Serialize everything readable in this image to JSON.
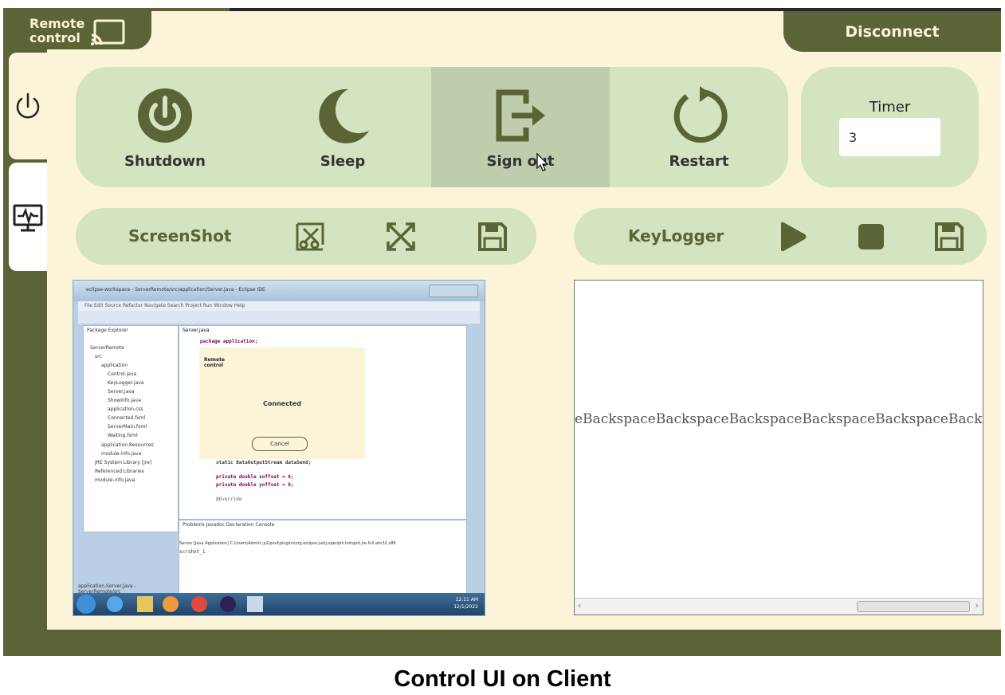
{
  "app": {
    "logo_line1": "Remote",
    "logo_line2": "control",
    "disconnect_label": "Disconnect"
  },
  "power": {
    "buttons": [
      {
        "label": "Shutdown",
        "icon": "power-icon"
      },
      {
        "label": "Sleep",
        "icon": "moon-icon"
      },
      {
        "label": "Sign out",
        "icon": "sign-out-icon",
        "hovered": true
      },
      {
        "label": "Restart",
        "icon": "restart-icon"
      }
    ]
  },
  "timer": {
    "label": "Timer",
    "value": "3"
  },
  "screenshot": {
    "label": "ScreenShot",
    "icons": [
      "crop-icon",
      "fullscreen-icon",
      "save-icon"
    ]
  },
  "keylogger": {
    "label": "KeyLogger",
    "icons": [
      "play-icon",
      "stop-icon",
      "save-icon"
    ],
    "log_text": "eBackspaceBackspaceBackspaceBackspaceBackspaceBackspace"
  },
  "remote_screen": {
    "window_title": "eclipse-workspace - ServerRemote/src/application/Server.java - Eclipse IDE",
    "menu": "File  Edit  Source  Refactor  Navigate  Search  Project  Run  Window  Help",
    "package_explorer_title": "Package Explorer",
    "tree": [
      "ServerRemote",
      "src",
      "application",
      "Control.java",
      "KeyLogger.java",
      "Server.java",
      "ShowInfo.java",
      "application.css",
      "Connected.fxml",
      "ServerMain.fxml",
      "Waiting.fxml",
      "application.Resources",
      "module-info.java",
      "JRE System Library [jre]",
      "Referenced Libraries",
      "module-info.java"
    ],
    "editor_tab": "Server.java",
    "code_line1": "package application;",
    "code_line2": "static DataOutputStream dataSend;",
    "code_line3": "private double xoffset = 0;",
    "code_line4": "private double yoffset = 0;",
    "code_line5": "@Override",
    "dialog_logo1": "Remote",
    "dialog_logo2": "control",
    "dialog_status": "Connected",
    "dialog_cancel": "Cancel",
    "console_tabs": "Problems  Javadoc  Declaration  Console",
    "console_line1": "Server [Java Application] C:\\Users\\Admin\\.p2\\pool\\plugins\\org.eclipse.justj.openjdk.hotspot.jre.full.win32.x86",
    "console_line2": "scrshot_1",
    "status_bar": "application.Server.java - ServerRemote/src",
    "clock_time": "12:11 AM",
    "clock_date": "12/1/2022"
  },
  "caption": "Control UI on Client",
  "colors": {
    "olive": "#5b6436",
    "cream": "#fbf4d8",
    "panel": "#d4e3c0",
    "panel_hover": "#bfcdad"
  }
}
